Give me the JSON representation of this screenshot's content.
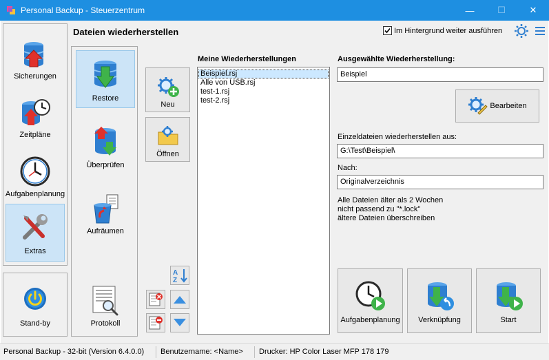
{
  "window": {
    "title": "Personal Backup - Steuerzentrum",
    "minimize": "—",
    "maximize": "☐",
    "close": "✕"
  },
  "header": {
    "title": "Dateien wiederherstellen",
    "background_checkbox_label": "Im Hintergrund weiter ausführen",
    "background_checked": true
  },
  "main_nav": [
    {
      "label": "Sicherungen",
      "icon": "database-upload-icon"
    },
    {
      "label": "Zeitpläne",
      "icon": "database-clock-icon"
    },
    {
      "label": "Aufgabenplanung",
      "icon": "clock-icon"
    },
    {
      "label": "Extras",
      "icon": "tools-icon",
      "active": true
    }
  ],
  "standby": {
    "label": "Stand-by",
    "icon": "power-icon"
  },
  "sub_nav": [
    {
      "label": "Restore",
      "icon": "database-download-icon",
      "active": true
    },
    {
      "label": "Überprüfen",
      "icon": "database-verify-icon"
    },
    {
      "label": "Aufräumen",
      "icon": "trash-icon"
    },
    {
      "label": "Protokoll",
      "icon": "log-search-icon"
    }
  ],
  "tools": {
    "new_label": "Neu",
    "open_label": "Öffnen"
  },
  "restores": {
    "heading": "Meine Wiederherstellungen",
    "items": [
      "Beispiel.rsj",
      "Alle von USB.rsj",
      "test-1.rsj",
      "test-2.rsj"
    ],
    "selected_index": 0
  },
  "details": {
    "heading": "Ausgewählte Wiederherstellung:",
    "name_value": "Beispiel",
    "edit_label": "Bearbeiten",
    "source_label": "Einzeldateien wiederherstellen aus:",
    "source_value": "G:\\Test\\Beispiel\\",
    "target_label": "Nach:",
    "target_value": "Originalverzeichnis",
    "notes": [
      "Alle Dateien älter als 2 Wochen",
      "nicht passend zu \"*.lock\"",
      "ältere Dateien überschreiben"
    ]
  },
  "actions": {
    "schedule_label": "Aufgabenplanung",
    "shortcut_label": "Verknüpfung",
    "start_label": "Start"
  },
  "statusbar": {
    "version": "Personal Backup - 32-bit (Version 6.4.0.0)",
    "user": "Benutzername: <Name>",
    "printer": "Drucker: HP Color Laser MFP 178 179"
  },
  "colors": {
    "titlebar": "#1e8fe1",
    "panel": "#f0f0f0",
    "active_nav": "#cce4f7",
    "selection": "#cce8ff",
    "db_blue": "#2f7fd0",
    "arrow_red": "#e0312b",
    "arrow_green": "#3fb34a"
  }
}
